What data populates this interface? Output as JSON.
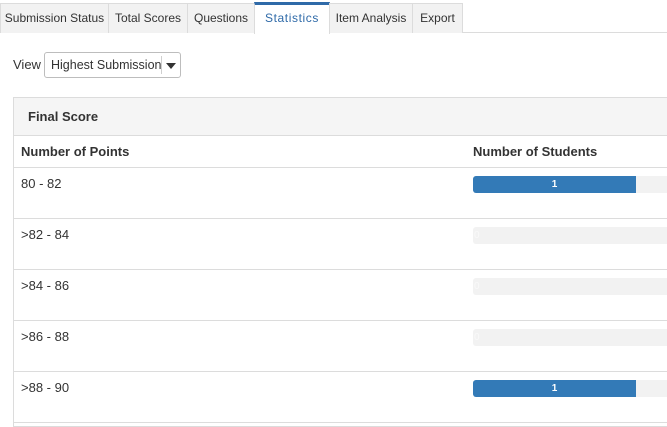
{
  "tabs": [
    {
      "label": "Submission Status",
      "active": false
    },
    {
      "label": "Total Scores",
      "active": false
    },
    {
      "label": "Questions",
      "active": false
    },
    {
      "label": "Statistics",
      "active": true
    },
    {
      "label": "Item Analysis",
      "active": false
    },
    {
      "label": "Export",
      "active": false
    }
  ],
  "view": {
    "label": "View",
    "selected": "Highest Submission"
  },
  "panel": {
    "title": "Final Score",
    "col_points": "Number of Points",
    "col_students": "Number of Students",
    "max_students": 1,
    "bar_color": "#337ab7",
    "rows": [
      {
        "range": "80 - 82",
        "count": 1,
        "count_text": "1"
      },
      {
        "range": ">82 - 84",
        "count": 0,
        "count_text": "0"
      },
      {
        "range": ">84 - 86",
        "count": 0,
        "count_text": "0"
      },
      {
        "range": ">86 - 88",
        "count": 0,
        "count_text": "0"
      },
      {
        "range": ">88 - 90",
        "count": 1,
        "count_text": "1"
      }
    ]
  }
}
